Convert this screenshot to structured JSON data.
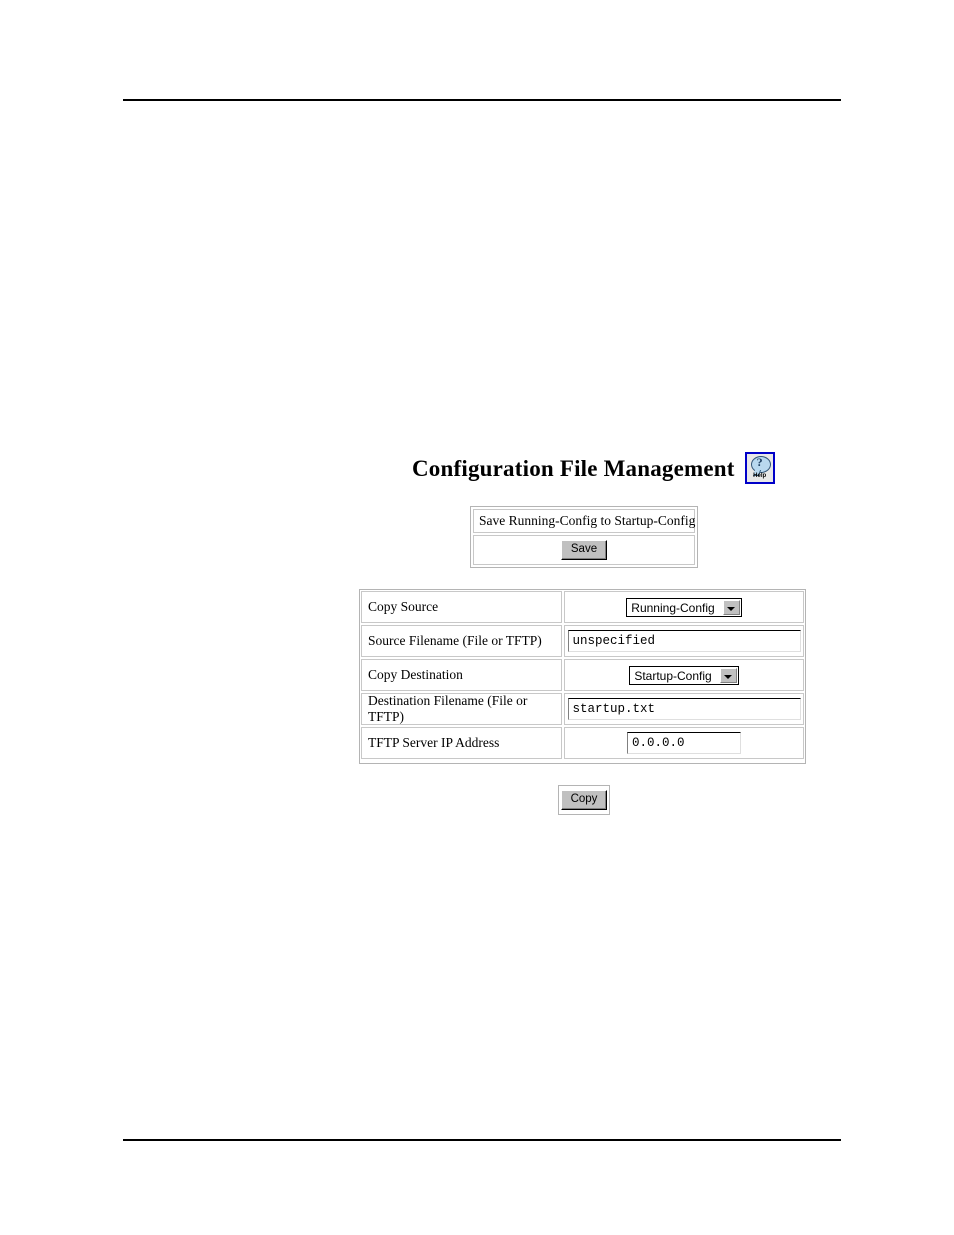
{
  "page": {
    "title": "Configuration File Management",
    "help_icon_label": "Help",
    "help_icon_glyph": "?"
  },
  "save_panel": {
    "header_label": "Save Running-Config to Startup-Config",
    "save_button_label": "Save"
  },
  "form": {
    "rows": [
      {
        "label": "Copy Source",
        "control": "select",
        "value": "Running-Config"
      },
      {
        "label": "Source Filename (File or TFTP)",
        "control": "text",
        "value": "unspecified"
      },
      {
        "label": "Copy Destination",
        "control": "select",
        "value": "Startup-Config"
      },
      {
        "label": "Destination Filename (File or TFTP)",
        "control": "text",
        "value": "startup.txt"
      },
      {
        "label": "TFTP Server IP Address",
        "control": "text-ip",
        "value": "0.0.0.0"
      }
    ]
  },
  "actions": {
    "copy_button_label": "Copy"
  },
  "colors": {
    "help_border": "#0000c8",
    "button_face": "#c0c0c0",
    "table_border": "#c8c8c8",
    "rule": "#000000"
  }
}
